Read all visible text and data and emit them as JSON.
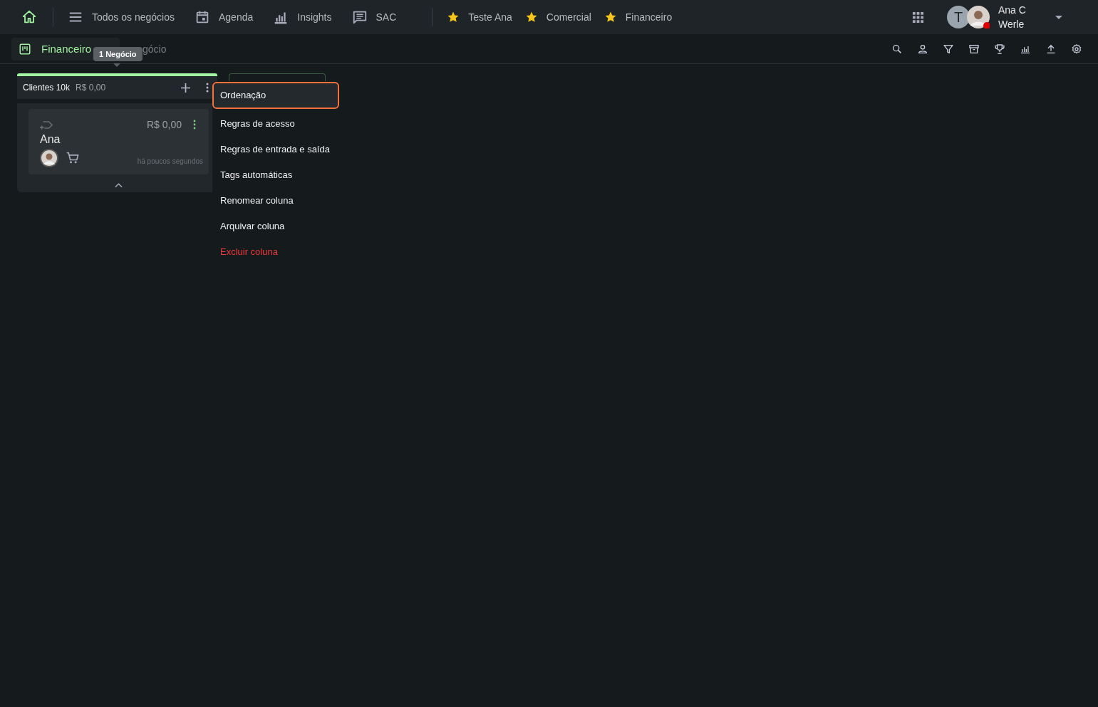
{
  "top_nav": {
    "items": [
      {
        "kind": "menu",
        "label": "Todos os negócios"
      },
      {
        "kind": "calendar",
        "label": "Agenda"
      },
      {
        "kind": "chart",
        "label": "Insights"
      },
      {
        "kind": "chat",
        "label": "SAC"
      }
    ],
    "favorites": [
      {
        "label": "Teste Ana"
      },
      {
        "label": "Comercial"
      },
      {
        "label": "Financeiro"
      }
    ],
    "user": {
      "initial": "T",
      "first_line": "Ana C",
      "second_line": "Werle"
    }
  },
  "board_tab": {
    "label": "Financeiro",
    "selected": true
  },
  "tooltip": "1 Negócio",
  "tooltip_covered_text": "gócio",
  "columns": [
    {
      "title": "Clientes 10k",
      "total": "R$ 0,00",
      "color": "#a3f5a3",
      "cards": [
        {
          "value": "R$ 0,00",
          "name": "Ana",
          "time": "há poucos segundos"
        }
      ]
    }
  ],
  "column_menu": [
    {
      "label": "Ordenação",
      "kind": "normal",
      "selected": true
    },
    {
      "label": "Regras de acesso",
      "kind": "normal",
      "selected": false
    },
    {
      "label": "Regras de entrada e saída",
      "kind": "normal",
      "selected": false
    },
    {
      "label": "Tags automáticas",
      "kind": "normal",
      "selected": false
    },
    {
      "label": "Renomear coluna",
      "kind": "normal",
      "selected": false
    },
    {
      "label": "Arquivar coluna",
      "kind": "normal",
      "selected": false
    },
    {
      "label": "Excluir coluna",
      "kind": "danger",
      "selected": false
    }
  ]
}
